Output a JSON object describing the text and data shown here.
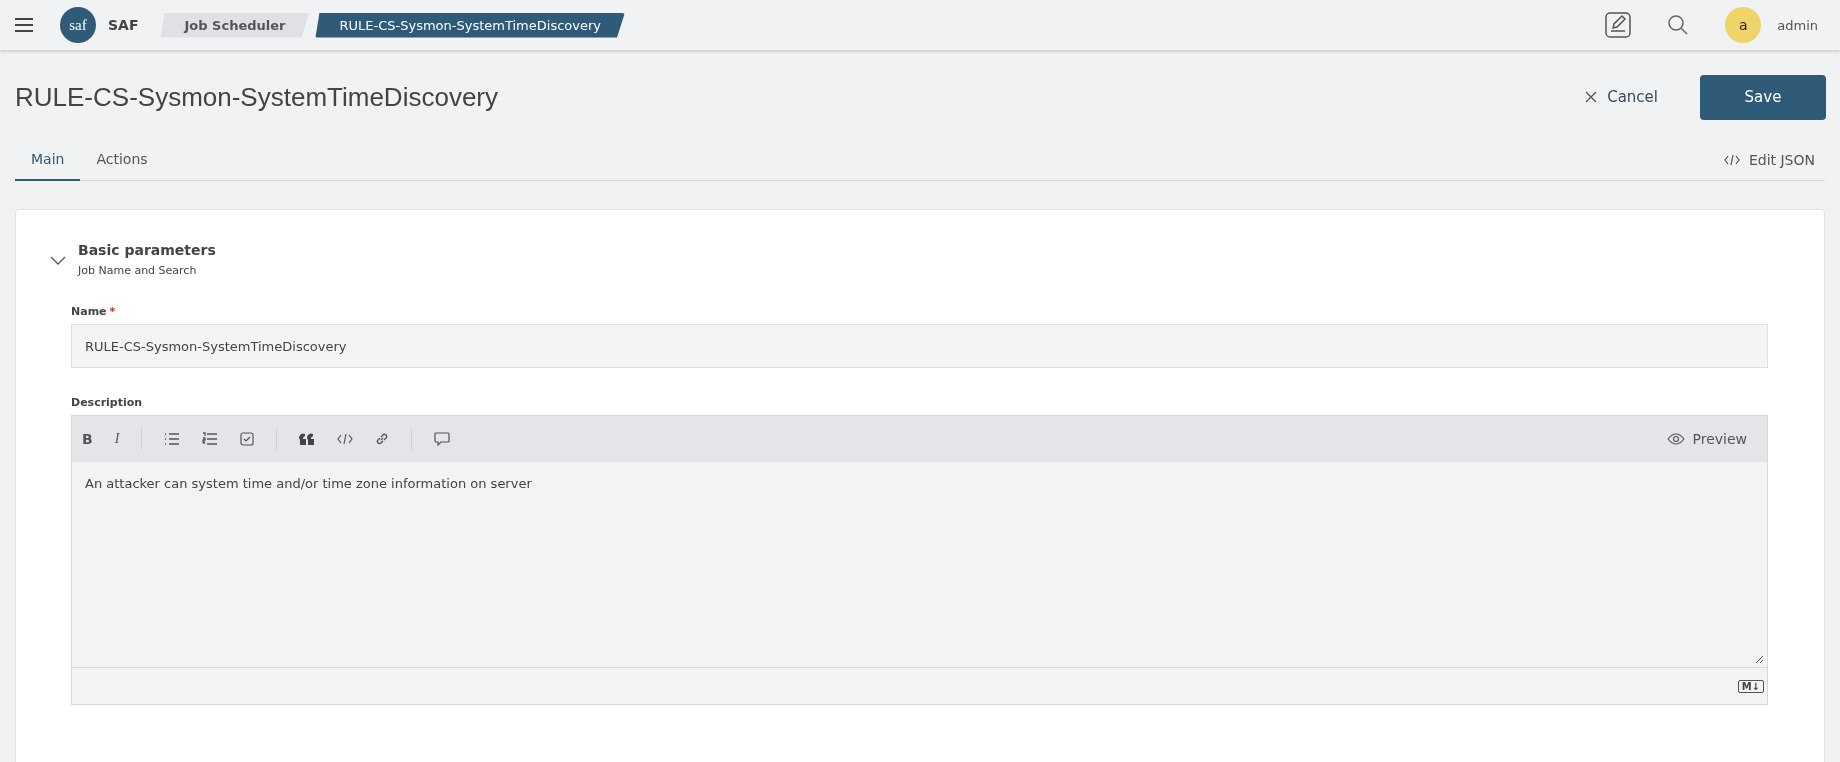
{
  "app": {
    "logo_text": "saf",
    "name": "SAF"
  },
  "breadcrumbs": [
    {
      "label": "Job Scheduler",
      "selected": false
    },
    {
      "label": "RULE-CS-Sysmon-SystemTimeDiscovery",
      "selected": true
    }
  ],
  "user": {
    "avatar_letter": "a",
    "name": "admin"
  },
  "page": {
    "title": "RULE-CS-Sysmon-SystemTimeDiscovery",
    "cancel": "Cancel",
    "save": "Save"
  },
  "tabs": [
    {
      "label": "Main",
      "selected": true
    },
    {
      "label": "Actions",
      "selected": false
    }
  ],
  "edit_json": "Edit JSON",
  "section": {
    "title": "Basic parameters",
    "subtitle": "Job Name and Search",
    "expanded": true
  },
  "name_field": {
    "label": "Name",
    "required": true,
    "required_mark": "*",
    "value": "RULE-CS-Sysmon-SystemTimeDiscovery"
  },
  "description": {
    "label": "Description",
    "toolbar": [
      [
        {
          "kind": "bold",
          "glyph": "B"
        },
        {
          "kind": "italic",
          "glyph": "I"
        }
      ],
      [
        {
          "kind": "bullets"
        },
        {
          "kind": "numbers"
        },
        {
          "kind": "task"
        }
      ],
      [
        {
          "kind": "quote"
        },
        {
          "kind": "code"
        },
        {
          "kind": "link"
        }
      ],
      [
        {
          "kind": "comment"
        }
      ]
    ],
    "preview": "Preview",
    "value": "An attacker can system time and/or time zone information on server",
    "markdown_badge": "M↓"
  }
}
